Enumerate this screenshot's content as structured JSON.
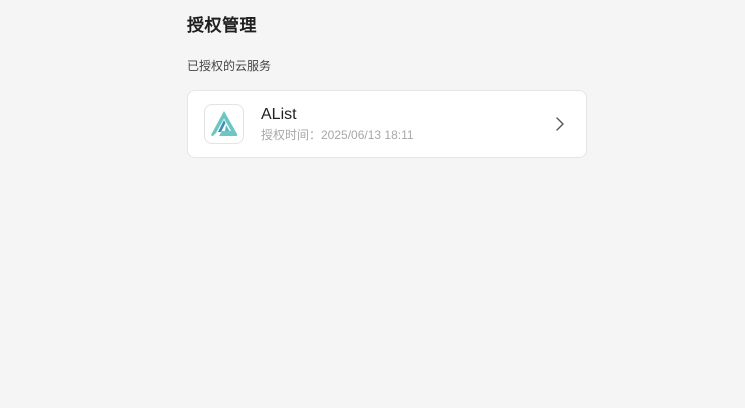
{
  "page": {
    "title": "授权管理",
    "section_label": "已授权的云服务"
  },
  "services": [
    {
      "name": "AList",
      "auth_time": "授权时间：2025/06/13 18:11",
      "icon": "alist-logo-icon"
    }
  ],
  "colors": {
    "background": "#f5f5f5",
    "card": "#ffffff",
    "logo_primary": "#5bc0be",
    "logo_secondary": "#3e8fb0",
    "muted_text": "#a8a8a8"
  }
}
